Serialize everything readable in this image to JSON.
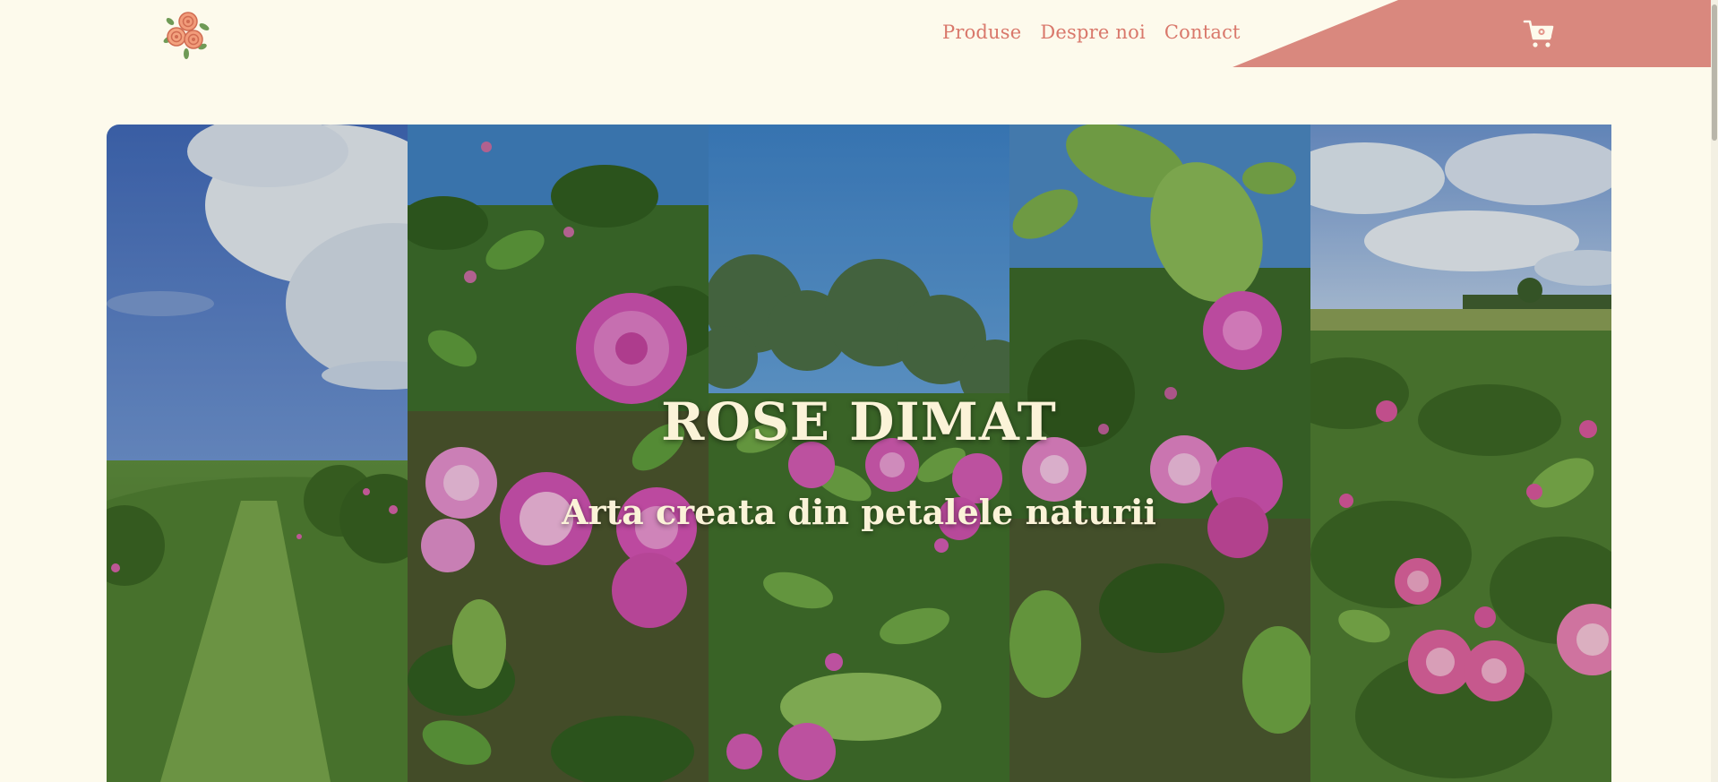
{
  "brand": {
    "logo_icon": "roses-logo-icon",
    "accent": "#d9786b",
    "corner_color": "#d9887e",
    "background": "#fdfaec"
  },
  "nav": {
    "items": [
      {
        "label": "Produse"
      },
      {
        "label": "Despre noi"
      },
      {
        "label": "Contact"
      }
    ]
  },
  "cart": {
    "icon": "shopping-cart-icon"
  },
  "hero": {
    "title": "ROSE DIMAT",
    "subtitle": "Arta creata din petalele naturii",
    "panels": [
      {
        "icon": "rose-field-sky-photo"
      },
      {
        "icon": "pink-roses-closeup-photo"
      },
      {
        "icon": "roses-trees-sky-photo"
      },
      {
        "icon": "rose-bush-leaves-photo"
      },
      {
        "icon": "rose-field-horizon-photo"
      }
    ]
  }
}
